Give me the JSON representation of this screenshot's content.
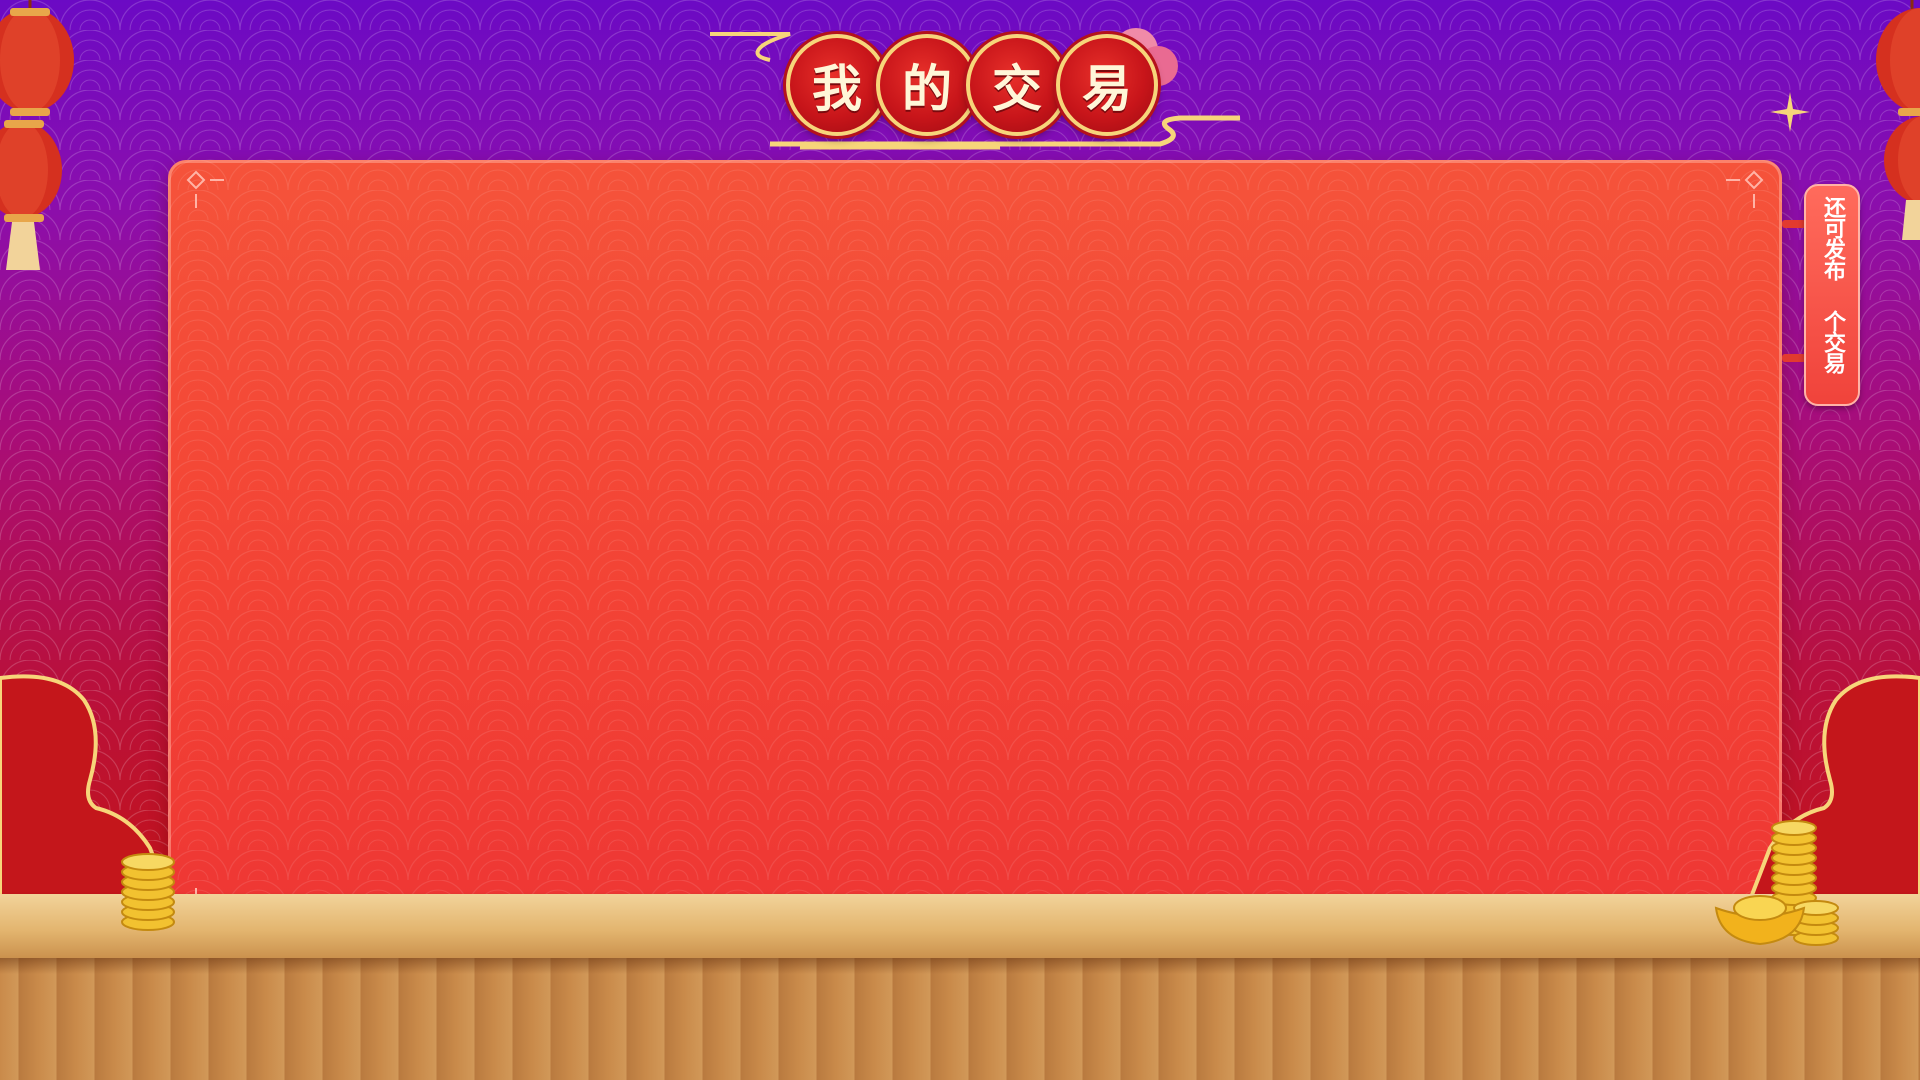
{
  "title": {
    "chars": [
      "我",
      "的",
      "交",
      "易"
    ]
  },
  "side_tab": {
    "line1": "还可发布",
    "line2": "个交易"
  },
  "colors": {
    "bg_top": "#6b0ac4",
    "bg_bottom": "#c2131f",
    "panel": "#f34335",
    "gold": "#f7d57a",
    "table": "#e3b56f"
  },
  "icons": [
    "lantern-icon",
    "cloud-icon",
    "gold-coin-icon",
    "gold-ingot-icon",
    "flower-icon",
    "sparkle-icon"
  ]
}
